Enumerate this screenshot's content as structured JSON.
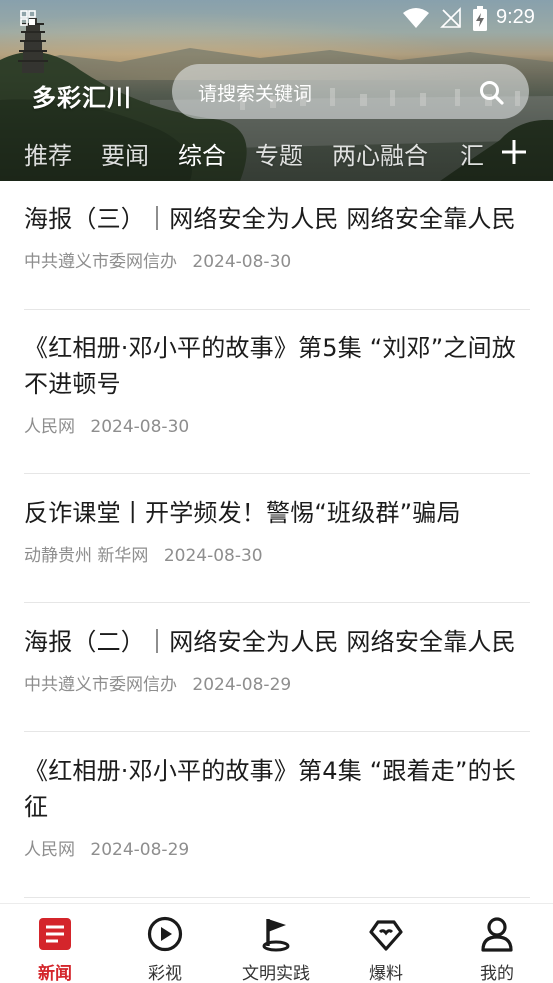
{
  "status_bar": {
    "time": "9:29"
  },
  "app": {
    "title": "多彩汇川"
  },
  "search": {
    "placeholder": "请搜索关键词"
  },
  "tabs": [
    {
      "label": "推荐"
    },
    {
      "label": "要闻"
    },
    {
      "label": "综合",
      "active": true
    },
    {
      "label": "专题"
    },
    {
      "label": "两心融合"
    },
    {
      "label": "汇"
    }
  ],
  "news": [
    {
      "title": "海报（三）｜网络安全为人民 网络安全靠人民",
      "source": "中共遵义市委网信办",
      "date": "2024-08-30"
    },
    {
      "title": "《红相册·邓小平的故事》第5集 “刘邓”之间放不进顿号",
      "source": "人民网",
      "date": "2024-08-30"
    },
    {
      "title": "反诈课堂丨开学频发！警惕“班级群”骗局",
      "source": "动静贵州 新华网",
      "date": "2024-08-30"
    },
    {
      "title": "海报（二）｜网络安全为人民 网络安全靠人民",
      "source": "中共遵义市委网信办",
      "date": "2024-08-29"
    },
    {
      "title": "《红相册·邓小平的故事》第4集 “跟着走”的长征",
      "source": "人民网",
      "date": "2024-08-29"
    }
  ],
  "bottom_nav": [
    {
      "label": "新闻",
      "icon": "news-icon",
      "active": true
    },
    {
      "label": "彩视",
      "icon": "play-icon"
    },
    {
      "label": "文明实践",
      "icon": "flag-icon"
    },
    {
      "label": "爆料",
      "icon": "heart-badge-icon"
    },
    {
      "label": "我的",
      "icon": "user-icon"
    }
  ],
  "colors": {
    "accent": "#d4252b",
    "text": "#1c1c1c",
    "meta": "#8e8e8e"
  }
}
